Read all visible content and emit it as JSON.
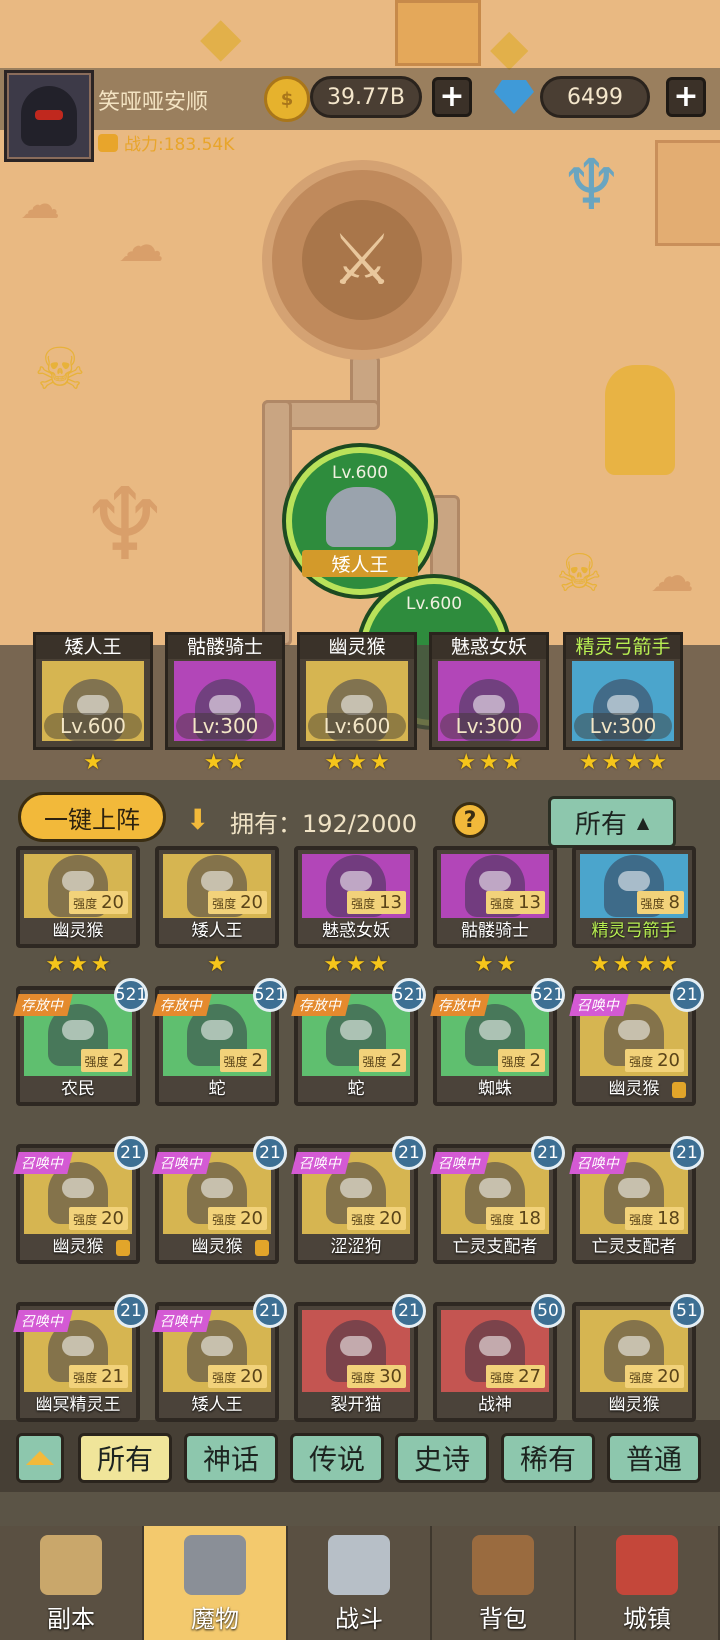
{
  "player": {
    "name": "笑哑哑安顺",
    "power": "战力:183.54K"
  },
  "currency": {
    "gold": "39.77B",
    "gems": "6499",
    "plus": "+"
  },
  "map": {
    "nodes": [
      {
        "level": "Lv.600",
        "name": "矮人王"
      },
      {
        "level": "Lv.600",
        "name": ""
      }
    ]
  },
  "lineup": [
    {
      "name": "矮人王",
      "level": "Lv.600",
      "stars": 1,
      "color": "#d6b551"
    },
    {
      "name": "骷髅骑士",
      "level": "Lv:300",
      "stars": 2,
      "color": "#b246b8"
    },
    {
      "name": "幽灵猴",
      "level": "Lv:600",
      "stars": 3,
      "color": "#d6b551"
    },
    {
      "name": "魅惑女妖",
      "level": "Lv:300",
      "stars": 3,
      "color": "#b246b8"
    },
    {
      "name": "精灵弓箭手",
      "level": "Lv:300",
      "stars": 4,
      "color": "#4ba5cc"
    }
  ],
  "inventory": {
    "auto_deploy": "一键上阵",
    "owned": "拥有：192/2000",
    "help": "?",
    "filter": "所有",
    "strength_label": "强度",
    "row0": [
      {
        "name": "幽灵猴",
        "strength": "20",
        "stars": 3,
        "color": "#d6b551"
      },
      {
        "name": "矮人王",
        "strength": "20",
        "stars": 1,
        "color": "#d6b551"
      },
      {
        "name": "魅惑女妖",
        "strength": "13",
        "stars": 3,
        "color": "#b246b8"
      },
      {
        "name": "骷髅骑士",
        "strength": "13",
        "stars": 2,
        "color": "#b246b8"
      },
      {
        "name": "精灵弓箭手",
        "strength": "8",
        "stars": 4,
        "color": "#4ba5cc"
      }
    ],
    "grid": [
      {
        "name": "农民",
        "strength": "2",
        "count": "521",
        "tag": "存放中",
        "tagType": "store",
        "color": "#5fbf6f",
        "lock": false
      },
      {
        "name": "蛇",
        "strength": "2",
        "count": "521",
        "tag": "存放中",
        "tagType": "store",
        "color": "#5fbf6f",
        "lock": false
      },
      {
        "name": "蛇",
        "strength": "2",
        "count": "521",
        "tag": "存放中",
        "tagType": "store",
        "color": "#5fbf6f",
        "lock": false
      },
      {
        "name": "蜘蛛",
        "strength": "2",
        "count": "521",
        "tag": "存放中",
        "tagType": "store",
        "color": "#5fbf6f",
        "lock": false
      },
      {
        "name": "幽灵猴",
        "strength": "20",
        "count": "21",
        "tag": "召唤中",
        "tagType": "summon",
        "color": "#d6b551",
        "lock": true
      },
      {
        "name": "幽灵猴",
        "strength": "20",
        "count": "21",
        "tag": "召唤中",
        "tagType": "summon",
        "color": "#d6b551",
        "lock": true
      },
      {
        "name": "幽灵猴",
        "strength": "20",
        "count": "21",
        "tag": "召唤中",
        "tagType": "summon",
        "color": "#d6b551",
        "lock": true
      },
      {
        "name": "涩涩狗",
        "strength": "20",
        "count": "21",
        "tag": "召唤中",
        "tagType": "summon",
        "color": "#d6b551",
        "lock": false
      },
      {
        "name": "亡灵支配者",
        "strength": "18",
        "count": "21",
        "tag": "召唤中",
        "tagType": "summon",
        "color": "#d6b551",
        "lock": false
      },
      {
        "name": "亡灵支配者",
        "strength": "18",
        "count": "21",
        "tag": "召唤中",
        "tagType": "summon",
        "color": "#d6b551",
        "lock": false
      },
      {
        "name": "幽冥精灵王",
        "strength": "21",
        "count": "21",
        "tag": "召唤中",
        "tagType": "summon",
        "color": "#d6b551",
        "lock": false
      },
      {
        "name": "矮人王",
        "strength": "20",
        "count": "21",
        "tag": "召唤中",
        "tagType": "summon",
        "color": "#d6b551",
        "lock": false
      },
      {
        "name": "裂开猫",
        "strength": "30",
        "count": "21",
        "tag": "",
        "tagType": "",
        "color": "#c45551",
        "lock": false
      },
      {
        "name": "战神",
        "strength": "27",
        "count": "50",
        "tag": "",
        "tagType": "",
        "color": "#c45551",
        "lock": false
      },
      {
        "name": "幽灵猴",
        "strength": "20",
        "count": "51",
        "tag": "",
        "tagType": "",
        "color": "#d6b551",
        "lock": false
      }
    ]
  },
  "rarity_filters": [
    "所有",
    "神话",
    "传说",
    "史诗",
    "稀有",
    "普通"
  ],
  "nav": [
    "副本",
    "魔物",
    "战斗",
    "背包",
    "城镇"
  ],
  "colors": {
    "gold": "#f2b93a",
    "accent_green": "#8dc7ad",
    "star": "#f5c51b"
  }
}
